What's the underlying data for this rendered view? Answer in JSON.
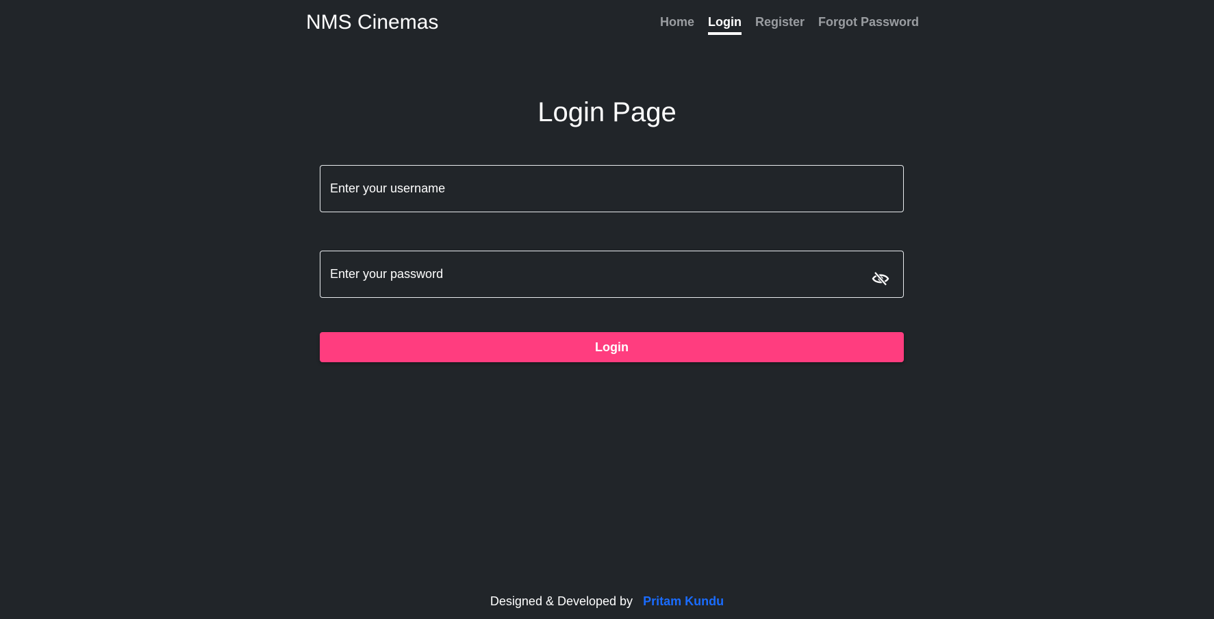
{
  "navbar": {
    "brand": "NMS Cinemas",
    "links": [
      {
        "label": "Home"
      },
      {
        "label": "Login",
        "active": true
      },
      {
        "label": "Register"
      },
      {
        "label": "Forgot Password"
      }
    ]
  },
  "main": {
    "title": "Login Page",
    "username": {
      "placeholder": "Enter your username",
      "value": ""
    },
    "password": {
      "placeholder": "Enter your password",
      "value": ""
    },
    "login_button": "Login"
  },
  "footer": {
    "text": "Designed & Developed by",
    "author": "Pritam Kundu"
  },
  "colors": {
    "background": "#212529",
    "accent": "#ff3d7f",
    "author_link": "#1a6cff"
  },
  "icons": {
    "password_toggle": "eye-slash-icon"
  }
}
